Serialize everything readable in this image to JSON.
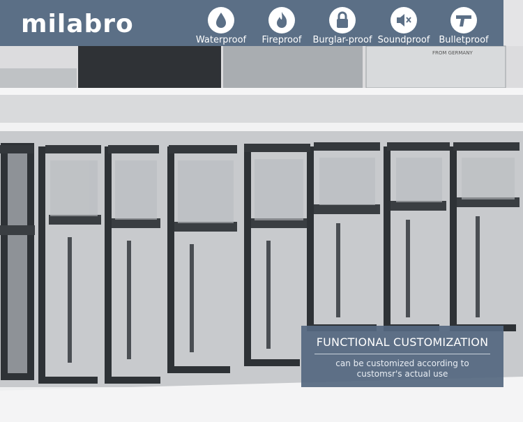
{
  "brand": {
    "logo_text": "milabro"
  },
  "features": [
    {
      "label": "Waterproof",
      "icon": "water-drop-icon"
    },
    {
      "label": "Fireproof",
      "icon": "flame-icon"
    },
    {
      "label": "Burglar-proof",
      "icon": "padlock-icon"
    },
    {
      "label": "Soundproof",
      "icon": "speaker-mute-icon"
    },
    {
      "label": "Bulletproof",
      "icon": "pistol-icon"
    }
  ],
  "colors": {
    "banner": "#5b6f86",
    "card": "#556880",
    "profile": "#2f3336"
  },
  "card": {
    "title": "FUNCTIONAL CUSTOMIZATION",
    "line1": "can be customized according to",
    "line2": "customsr's  actual use"
  },
  "background_labels": {
    "box_label": "FROM GERMANY"
  }
}
